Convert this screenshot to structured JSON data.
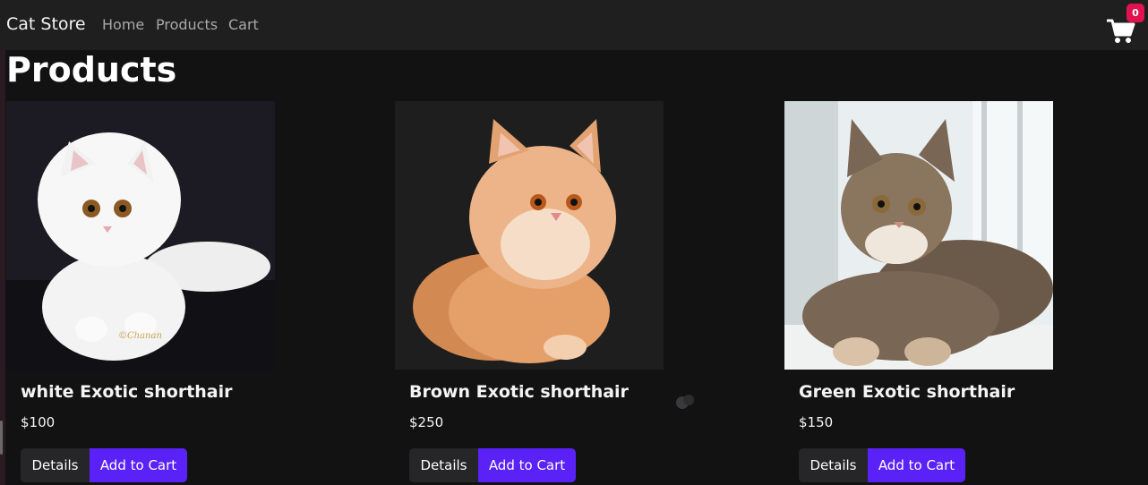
{
  "navbar": {
    "brand": "Cat Store",
    "links": [
      "Home",
      "Products",
      "Cart"
    ],
    "cart_count": "0",
    "cart_icon": "shopping-cart-icon"
  },
  "page": {
    "title": "Products"
  },
  "products": [
    {
      "name": "white Exotic shorthair",
      "price": "$100",
      "details_label": "Details",
      "add_label": "Add to Cart",
      "photo_signature": "©Chanan"
    },
    {
      "name": "Brown Exotic shorthair",
      "price": "$250",
      "details_label": "Details",
      "add_label": "Add to Cart"
    },
    {
      "name": "Green Exotic shorthair",
      "price": "$150",
      "details_label": "Details",
      "add_label": "Add to Cart"
    }
  ],
  "colors": {
    "background": "#121212",
    "navbar": "#1f1f20",
    "accent": "#5a22f7",
    "badge": "#e0134f",
    "details_button": "#262628"
  }
}
